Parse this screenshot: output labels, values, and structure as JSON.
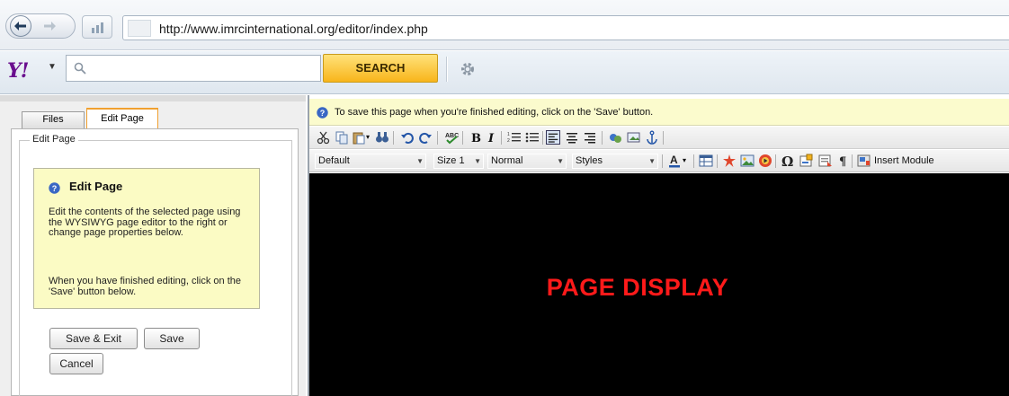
{
  "browser": {
    "url": "http://www.imrcinternational.org/editor/index.php"
  },
  "yahoo_toolbar": {
    "logo_text": "Y!",
    "search_placeholder": "",
    "search_button": "SEARCH"
  },
  "left_panel": {
    "tabs": [
      {
        "label": "Files",
        "active": false
      },
      {
        "label": "Edit Page",
        "active": true
      }
    ],
    "fieldset_legend": "Edit Page",
    "help": {
      "title": "Edit Page",
      "paragraph1": "Edit the contents of the selected page using the WYSIWYG page editor to the right or change page properties below.",
      "paragraph2": "When you have finished editing, click on the 'Save' button below."
    },
    "buttons": {
      "save_exit": "Save & Exit",
      "save": "Save",
      "cancel": "Cancel"
    }
  },
  "editor": {
    "info_message": "To save this page when you're finished editing, click on the 'Save' button.",
    "toolbar2": {
      "font_family": "Default",
      "font_size": "Size 1",
      "paragraph_format": "Normal",
      "styles": "Styles",
      "insert_module": "Insert Module"
    },
    "canvas_text": "PAGE DISPLAY"
  },
  "colors": {
    "canvas_background": "#000000",
    "canvas_text": "#ff1a1a",
    "help_background": "#fbfbc4",
    "search_button": "#f8b51b",
    "yahoo_purple": "#6a0f8e",
    "active_tab_border": "#f0a030"
  },
  "icons": {
    "nav": [
      "back-arrow-icon",
      "forward-arrow-icon",
      "stats-icon",
      "favicon-icon",
      "search-icon",
      "gear-icon",
      "help-icon",
      "info-icon"
    ],
    "toolbar1": [
      "cut-icon",
      "copy-icon",
      "paste-icon",
      "find-icon",
      "undo-icon",
      "redo-icon",
      "spellcheck-icon",
      "bold-icon",
      "italic-icon",
      "ordered-list-icon",
      "unordered-list-icon",
      "align-left-icon",
      "align-center-icon",
      "align-right-icon",
      "link-icon",
      "image-link-icon",
      "anchor-icon"
    ],
    "toolbar2": [
      "font-color-icon",
      "table-icon",
      "flash-icon",
      "image-icon",
      "media-icon",
      "special-char-icon",
      "form-icon",
      "template-icon",
      "paragraph-mark-icon",
      "insert-module-icon"
    ]
  }
}
